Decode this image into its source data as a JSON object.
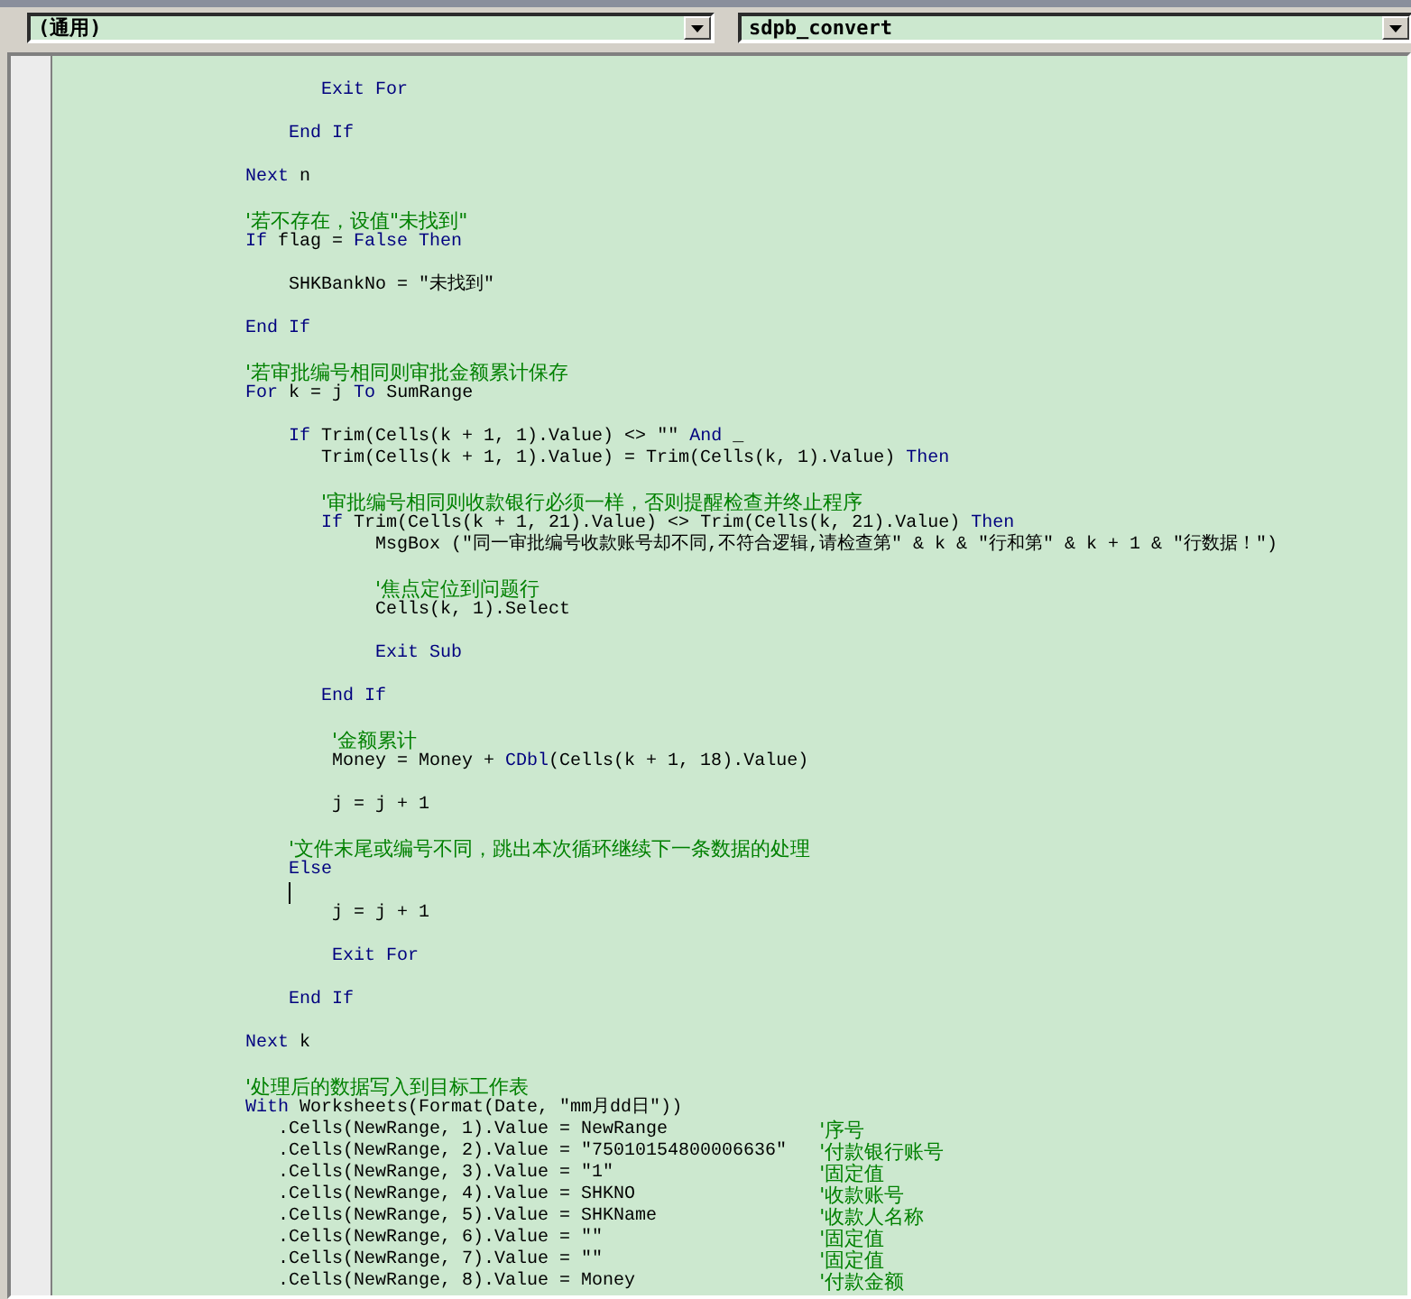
{
  "object_dropdown": {
    "value": "(通用)"
  },
  "procedure_dropdown": {
    "value": "sdpb_convert"
  },
  "code_lines": [
    {
      "kind": "code",
      "tokens": [
        {
          "kind": "keyword",
          "text": "           Exit For"
        }
      ]
    },
    {
      "kind": "blank"
    },
    {
      "kind": "code",
      "tokens": [
        {
          "kind": "keyword",
          "text": "        End If"
        }
      ]
    },
    {
      "kind": "blank"
    },
    {
      "kind": "code",
      "tokens": [
        {
          "kind": "keyword",
          "text": "    Next"
        },
        {
          "kind": "plain",
          "text": " n"
        }
      ]
    },
    {
      "kind": "blank"
    },
    {
      "kind": "code",
      "comment": "    '若不存在，设值\"未找到\""
    },
    {
      "kind": "code",
      "tokens": [
        {
          "kind": "keyword",
          "text": "    If"
        },
        {
          "kind": "plain",
          "text": " flag = "
        },
        {
          "kind": "keyword",
          "text": "False Then"
        }
      ]
    },
    {
      "kind": "blank"
    },
    {
      "kind": "code",
      "tokens": [
        {
          "kind": "plain",
          "text": "        SHKBankNo = \"未找到\""
        }
      ]
    },
    {
      "kind": "blank"
    },
    {
      "kind": "code",
      "tokens": [
        {
          "kind": "keyword",
          "text": "    End If"
        }
      ]
    },
    {
      "kind": "blank"
    },
    {
      "kind": "code",
      "comment": "    '若审批编号相同则审批金额累计保存"
    },
    {
      "kind": "code",
      "tokens": [
        {
          "kind": "keyword",
          "text": "    For"
        },
        {
          "kind": "plain",
          "text": " k = j "
        },
        {
          "kind": "keyword",
          "text": "To"
        },
        {
          "kind": "plain",
          "text": " SumRange"
        }
      ]
    },
    {
      "kind": "blank"
    },
    {
      "kind": "code",
      "tokens": [
        {
          "kind": "keyword",
          "text": "        If"
        },
        {
          "kind": "plain",
          "text": " Trim(Cells(k + 1, 1).Value) <> \"\" "
        },
        {
          "kind": "keyword",
          "text": "And"
        },
        {
          "kind": "plain",
          "text": " _"
        }
      ]
    },
    {
      "kind": "code",
      "tokens": [
        {
          "kind": "plain",
          "text": "           Trim(Cells(k + 1, 1).Value) = Trim(Cells(k, 1).Value) "
        },
        {
          "kind": "keyword",
          "text": "Then"
        }
      ]
    },
    {
      "kind": "blank"
    },
    {
      "kind": "code",
      "comment": "           '审批编号相同则收款银行必须一样，否则提醒检查并终止程序"
    },
    {
      "kind": "code",
      "tokens": [
        {
          "kind": "keyword",
          "text": "           If"
        },
        {
          "kind": "plain",
          "text": " Trim(Cells(k + 1, 21).Value) <> Trim(Cells(k, 21).Value) "
        },
        {
          "kind": "keyword",
          "text": "Then"
        }
      ]
    },
    {
      "kind": "code",
      "tokens": [
        {
          "kind": "plain",
          "text": "                MsgBox (\"同一审批编号收款账号却不同,不符合逻辑,请检查第\" & k & \"行和第\" & k + 1 & \"行数据！\")"
        }
      ]
    },
    {
      "kind": "blank"
    },
    {
      "kind": "code",
      "comment": "                '焦点定位到问题行"
    },
    {
      "kind": "code",
      "tokens": [
        {
          "kind": "plain",
          "text": "                Cells(k, 1).Select"
        }
      ]
    },
    {
      "kind": "blank"
    },
    {
      "kind": "code",
      "tokens": [
        {
          "kind": "keyword",
          "text": "                Exit Sub"
        }
      ]
    },
    {
      "kind": "blank"
    },
    {
      "kind": "code",
      "tokens": [
        {
          "kind": "keyword",
          "text": "           End If"
        }
      ]
    },
    {
      "kind": "blank"
    },
    {
      "kind": "code",
      "comment": "            '金额累计"
    },
    {
      "kind": "code",
      "tokens": [
        {
          "kind": "plain",
          "text": "            Money = Money + "
        },
        {
          "kind": "keyword",
          "text": "CDbl"
        },
        {
          "kind": "plain",
          "text": "(Cells(k + 1, 18).Value)"
        }
      ]
    },
    {
      "kind": "blank"
    },
    {
      "kind": "code",
      "tokens": [
        {
          "kind": "plain",
          "text": "            j = j + 1"
        }
      ]
    },
    {
      "kind": "blank"
    },
    {
      "kind": "code",
      "comment": "        '文件末尾或编号不同，跳出本次循环继续下一条数据的处理"
    },
    {
      "kind": "code",
      "tokens": [
        {
          "kind": "keyword",
          "text": "        Else"
        }
      ]
    },
    {
      "kind": "cursor"
    },
    {
      "kind": "code",
      "tokens": [
        {
          "kind": "plain",
          "text": "            j = j + 1"
        }
      ]
    },
    {
      "kind": "blank"
    },
    {
      "kind": "code",
      "tokens": [
        {
          "kind": "keyword",
          "text": "            Exit For"
        }
      ]
    },
    {
      "kind": "blank"
    },
    {
      "kind": "code",
      "tokens": [
        {
          "kind": "keyword",
          "text": "        End If"
        }
      ]
    },
    {
      "kind": "blank"
    },
    {
      "kind": "code",
      "tokens": [
        {
          "kind": "keyword",
          "text": "    Next"
        },
        {
          "kind": "plain",
          "text": " k"
        }
      ]
    },
    {
      "kind": "blank"
    },
    {
      "kind": "code",
      "comment": "    '处理后的数据写入到目标工作表"
    },
    {
      "kind": "code",
      "tokens": [
        {
          "kind": "keyword",
          "text": "    With"
        },
        {
          "kind": "plain",
          "text": " Worksheets(Format(Date, \"mm月dd日\"))"
        }
      ]
    },
    {
      "kind": "code",
      "tokens": [
        {
          "kind": "plain",
          "text": "       .Cells(NewRange, 1).Value = NewRange"
        }
      ],
      "comment": "'序号"
    },
    {
      "kind": "code",
      "tokens": [
        {
          "kind": "plain",
          "text": "       .Cells(NewRange, 2).Value = \"75010154800006636\""
        }
      ],
      "comment": "'付款银行账号"
    },
    {
      "kind": "code",
      "tokens": [
        {
          "kind": "plain",
          "text": "       .Cells(NewRange, 3).Value = \"1\""
        }
      ],
      "comment": "'固定值"
    },
    {
      "kind": "code",
      "tokens": [
        {
          "kind": "plain",
          "text": "       .Cells(NewRange, 4).Value = SHKNO"
        }
      ],
      "comment": "'收款账号"
    },
    {
      "kind": "code",
      "tokens": [
        {
          "kind": "plain",
          "text": "       .Cells(NewRange, 5).Value = SHKName"
        }
      ],
      "comment": "'收款人名称"
    },
    {
      "kind": "code",
      "tokens": [
        {
          "kind": "plain",
          "text": "       .Cells(NewRange, 6).Value = \"\""
        }
      ],
      "comment": "'固定值"
    },
    {
      "kind": "code",
      "tokens": [
        {
          "kind": "plain",
          "text": "       .Cells(NewRange, 7).Value = \"\""
        }
      ],
      "comment": "'固定值"
    },
    {
      "kind": "code",
      "tokens": [
        {
          "kind": "plain",
          "text": "       .Cells(NewRange, 8).Value = Money"
        }
      ],
      "comment": "'付款金额"
    }
  ]
}
